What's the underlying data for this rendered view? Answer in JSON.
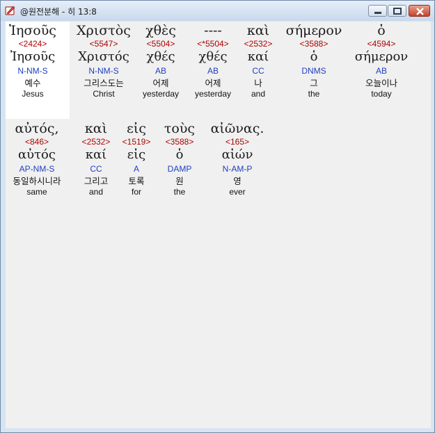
{
  "window": {
    "title": "@원전분해 - 히 13:8"
  },
  "rows": [
    [
      {
        "greek": "Ἰησοῦς",
        "strong": "<2424>",
        "lemma": "Ἰησοῦς",
        "parse": "N-NM-S",
        "korean": "예수",
        "english": "Jesus"
      },
      {
        "greek": "Χριστὸς",
        "strong": "<5547>",
        "lemma": "Χριστός",
        "parse": "N-NM-S",
        "korean": "그리스도는",
        "english": "Christ"
      },
      {
        "greek": "χθὲς",
        "strong": "<5504>",
        "lemma": "χθές",
        "parse": "AB",
        "korean": "어제",
        "english": "yesterday"
      },
      {
        "greek": "----",
        "strong": "<*5504>",
        "lemma": "χθές",
        "parse": "AB",
        "korean": "어제",
        "english": "yesterday"
      },
      {
        "greek": "καὶ",
        "strong": "<2532>",
        "lemma": "καί",
        "parse": "CC",
        "korean": "나",
        "english": "and"
      },
      {
        "greek": "σήμερον",
        "strong": "<3588>",
        "lemma": "ὁ",
        "parse": "DNMS",
        "korean": "그",
        "english": "the"
      },
      {
        "greek": "ὁ",
        "strong": "<4594>",
        "lemma": "σήμερον",
        "parse": "AB",
        "korean": "오늘이나",
        "english": "today"
      }
    ],
    [
      {
        "greek": "αὐτός,",
        "strong": "<846>",
        "lemma": "αὐτός",
        "parse": "AP-NM-S",
        "korean": "동일하시니라",
        "english": "same"
      },
      {
        "greek": "καὶ",
        "strong": "<2532>",
        "lemma": "καί",
        "parse": "CC",
        "korean": "그리고",
        "english": "and"
      },
      {
        "greek": "εἰς",
        "strong": "<1519>",
        "lemma": "εἰς",
        "parse": "A",
        "korean": "토록",
        "english": "for"
      },
      {
        "greek": "τοὺς",
        "strong": "<3588>",
        "lemma": "ὁ",
        "parse": "DAMP",
        "korean": "원",
        "english": "the"
      },
      {
        "greek": "αἰῶνας.",
        "strong": "<165>",
        "lemma": "αἰών",
        "parse": "N-AM-P",
        "korean": "영",
        "english": "ever"
      }
    ]
  ]
}
